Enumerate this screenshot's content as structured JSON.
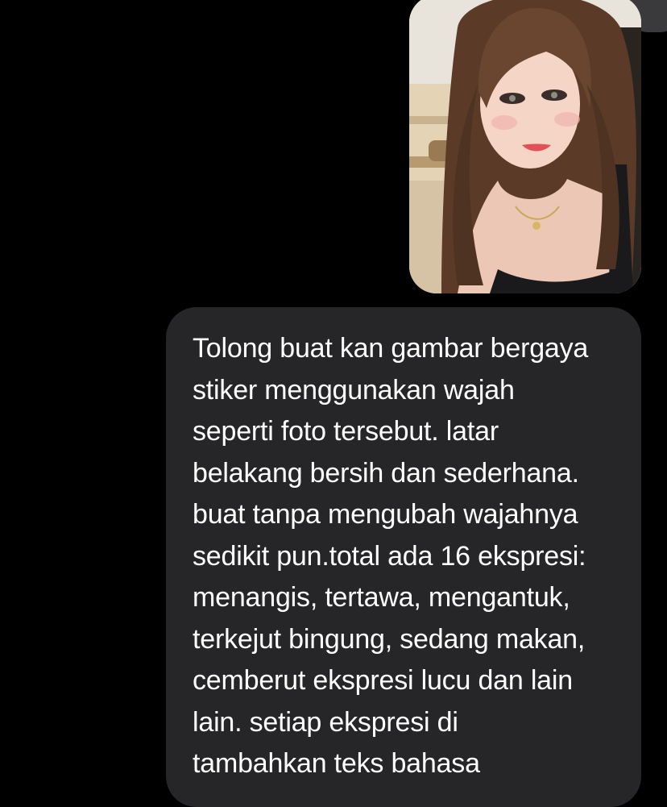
{
  "conversation": {
    "attachment": {
      "icon": "photo-thumbnail",
      "alt_colors": {
        "wall": "#e9dcc6",
        "hair": "#5a3a26",
        "skin": "#f3d2c2",
        "top": "#1b1b1d"
      }
    },
    "outgoing_message": {
      "text": "Tolong buat kan gambar bergaya\nstiker menggunakan wajah\nseperti foto tersebut. latar\nbelakang bersih dan sederhana.\nbuat tanpa mengubah wajahnya\nsedikit pun.total ada 16 ekspresi:\nmenangis, tertawa, mengantuk,\nterkejut bingung, sedang makan,\ncemberut ekspresi lucu dan lain\nlain. setiap ekspresi di\ntambahkan teks bahasa"
    }
  },
  "theme": {
    "background": "#000000",
    "bubble": "#262628",
    "text": "#ffffff"
  }
}
